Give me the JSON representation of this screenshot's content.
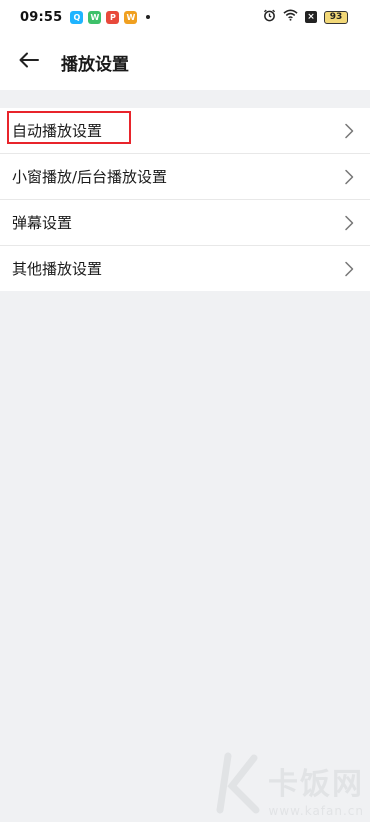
{
  "status_bar": {
    "time": "09:55",
    "battery": "93",
    "app_icons": [
      {
        "name": "qq-icon",
        "color": "#1fb4ff",
        "glyph": "Q"
      },
      {
        "name": "wechat-icon",
        "color": "#3ec16a",
        "glyph": "W"
      },
      {
        "name": "pinduoduo-icon",
        "color": "#e8493b",
        "glyph": "P"
      },
      {
        "name": "weibo-icon",
        "color": "#f0a020",
        "glyph": "W"
      }
    ]
  },
  "header": {
    "title": "播放设置"
  },
  "settings": {
    "items": [
      {
        "label": "自动播放设置"
      },
      {
        "label": "小窗播放/后台播放设置"
      },
      {
        "label": "弹幕设置"
      },
      {
        "label": "其他播放设置"
      }
    ]
  },
  "watermark": {
    "brand": "卡饭网",
    "domain": "www.kafan.cn"
  },
  "colors": {
    "highlight": "#e8242b",
    "background": "#f0f1f3"
  }
}
